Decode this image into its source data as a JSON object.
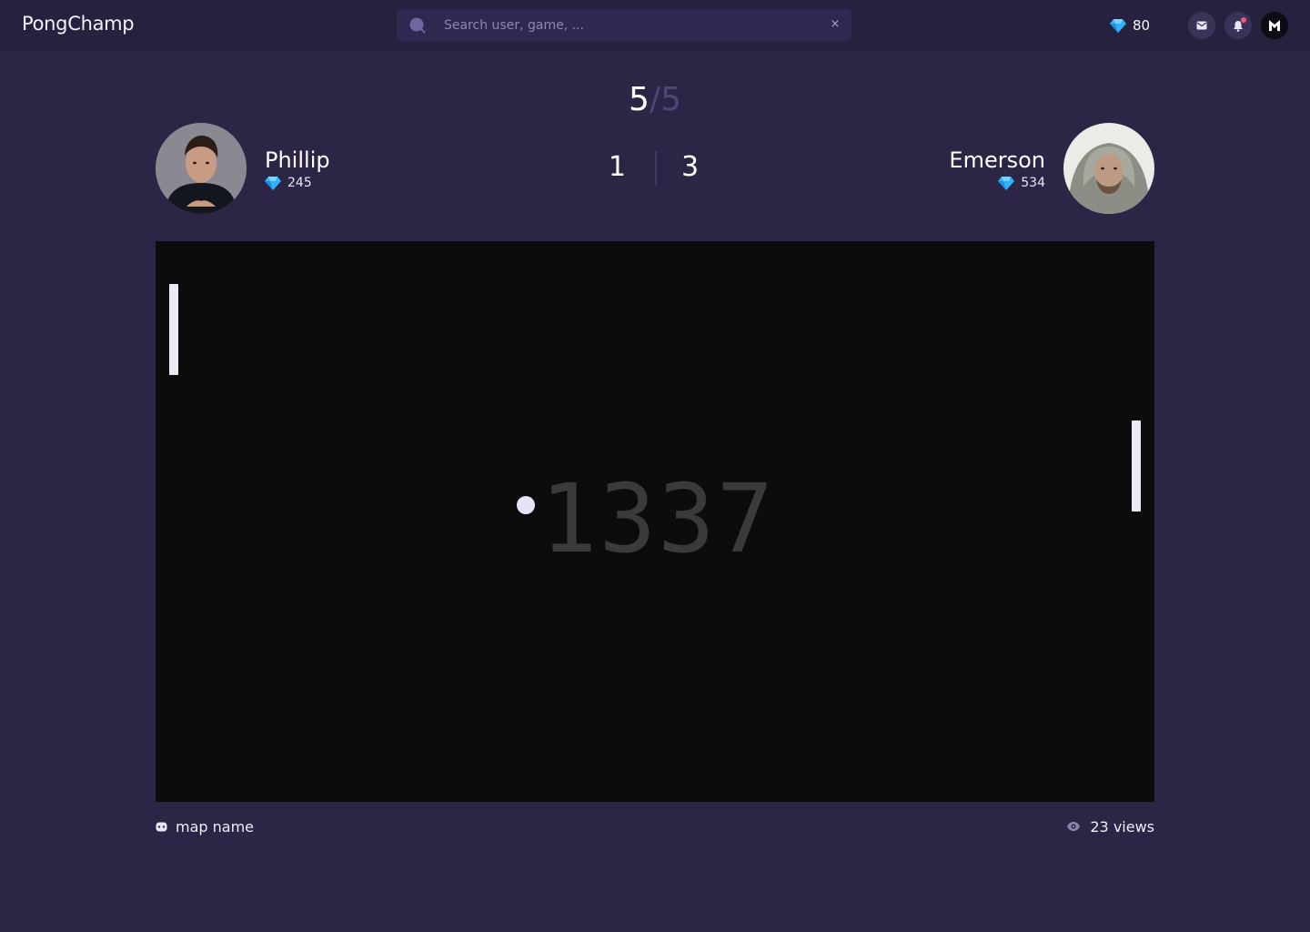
{
  "app": {
    "logo": "PongChamp"
  },
  "search": {
    "placeholder": "Search user, game, ...",
    "value": "",
    "clear_label": "×"
  },
  "wallet": {
    "gems": "80"
  },
  "header_icons": [
    "mail-icon",
    "bell-icon",
    "user-avatar-icon"
  ],
  "match": {
    "round_current": "5",
    "round_separator": "/",
    "round_total": "5",
    "score_left": "1",
    "score_right": "3",
    "player_left": {
      "name": "Phillip",
      "rating": "245"
    },
    "player_right": {
      "name": "Emerson",
      "rating": "534"
    }
  },
  "board": {
    "watermark": "1337"
  },
  "footer": {
    "map_name": "map name",
    "views": "23 views"
  },
  "colors": {
    "background": "#2c2546",
    "topbar": "#272140",
    "board": "#0c0c0d",
    "gem": "#2fb3ff",
    "paddle": "#ece9f7",
    "notification": "#f0587a"
  }
}
